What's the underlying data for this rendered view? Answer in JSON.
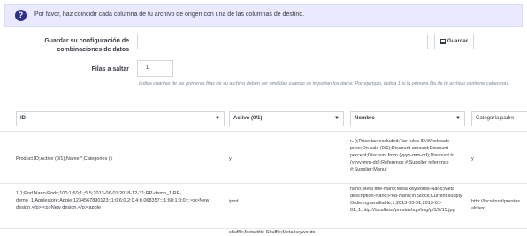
{
  "alert": {
    "icon": "question-icon",
    "message": "Por favor, haz coincidir cada columna de tu archivo de origen con una de las columnas de destino."
  },
  "config": {
    "label": "Guardar su configuración de combinaciones de datos",
    "input_value": "",
    "save_label": "Guardar"
  },
  "skip": {
    "label": "Filas a saltar",
    "value": "1",
    "help": "Indica cuántas de las primeras filas de su archivo deben ser omitidas cuando se importan los datos. Por ejemplo, indica 1 si la primera fila de tu archivo contiene cabeceras."
  },
  "columns": [
    {
      "label": "ID"
    },
    {
      "label": "Activo (0/1)"
    },
    {
      "label": "Nombre"
    },
    {
      "label": "Categoría padre"
    }
  ],
  "rows": [
    {
      "c1": "Product ID;Active (0/1);Name *;Categories (x",
      "c2": "y",
      "c3": "r...);Price tax excluded;Tax rules ID;Wholesale price;On sale (0/1);Discount amount;Discount percent;Discount from (yyyy-mm-dd);Discount to (yyyy-mm-dd);Reference #;Supplier reference #;Supplier;Manuf",
      "c4": "y"
    },
    {
      "c1": "1;1;Pod Nano;Pods;100;1;60;1;;5.5;2013-06-01;2018-12-31;RP-demo_1;RP-demo_1;Applestore;Apple;1234567890123;;1;0,6;0,2;0,4;0,068357;;;1;60;1;0;0;;;;<p>New design.</p>;<p>New design.</p>;apple",
      "c2": "ipod",
      "c3": "nano;Meta title-Nano;Meta keywords-Nano;Meta description-Nano;Pod-Nano;In Stock;Current supply. Ordering availlable;1;2013-03-01;2013-01-01;;1;http://localhost/prestashop/img/p/1/5/15.jpg",
      "c4": "http://localhost/prestas alt text"
    },
    {
      "c1": "",
      "c2": "",
      "c3": "",
      "c4": "",
      "cut": "shuffle;Meta title-Shuffle;Meta keywords-"
    }
  ]
}
